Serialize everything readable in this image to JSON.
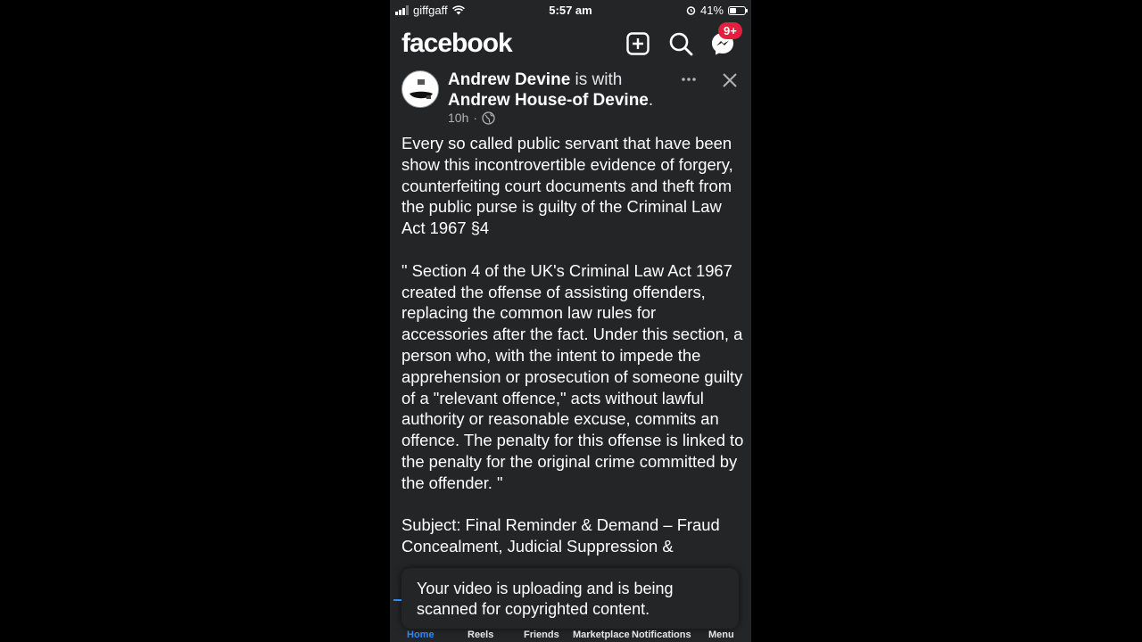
{
  "status_bar": {
    "carrier": "giffgaff",
    "time": "5:57 am",
    "battery_percent": "41%",
    "battery_level": 0.41
  },
  "header": {
    "logo": "facebook",
    "notification_badge": "9+",
    "icons": [
      "add-icon",
      "search-icon",
      "messenger-icon"
    ]
  },
  "post": {
    "author": "Andrew Devine",
    "with_text": "is with",
    "tagged": "Andrew House-of Devine",
    "period": ".",
    "time": "10h",
    "separator": "·",
    "paragraphs": [
      "Every so called public servant that have been show this incontrovertible evidence of forgery, counterfeiting court documents and theft from the public purse is guilty of the Criminal Law Act 1967 §4",
      "\" Section 4 of the UK's Criminal Law Act 1967 created the offense of assisting offenders, replacing the common law rules for accessories after the fact. Under this section, a person who, with the intent to impede the apprehension or prosecution of someone guilty of a \"relevant offence,\" acts without lawful authority or reasonable excuse, commits an offence. The penalty for this offense is linked to the penalty for the original crime committed by the offender. \"",
      "Subject: Final Reminder & Demand – Fraud Concealment, Judicial Suppression &"
    ]
  },
  "toast": {
    "message": "Your video is uploading and is being scanned for copyrighted content."
  },
  "nav": {
    "items": [
      "Home",
      "Reels",
      "Friends",
      "Marketplace",
      "Notifications",
      "Menu"
    ],
    "active": "Home"
  },
  "colors": {
    "background": "#242526",
    "accent": "#2d88ff",
    "badge": "#e41e3f"
  }
}
